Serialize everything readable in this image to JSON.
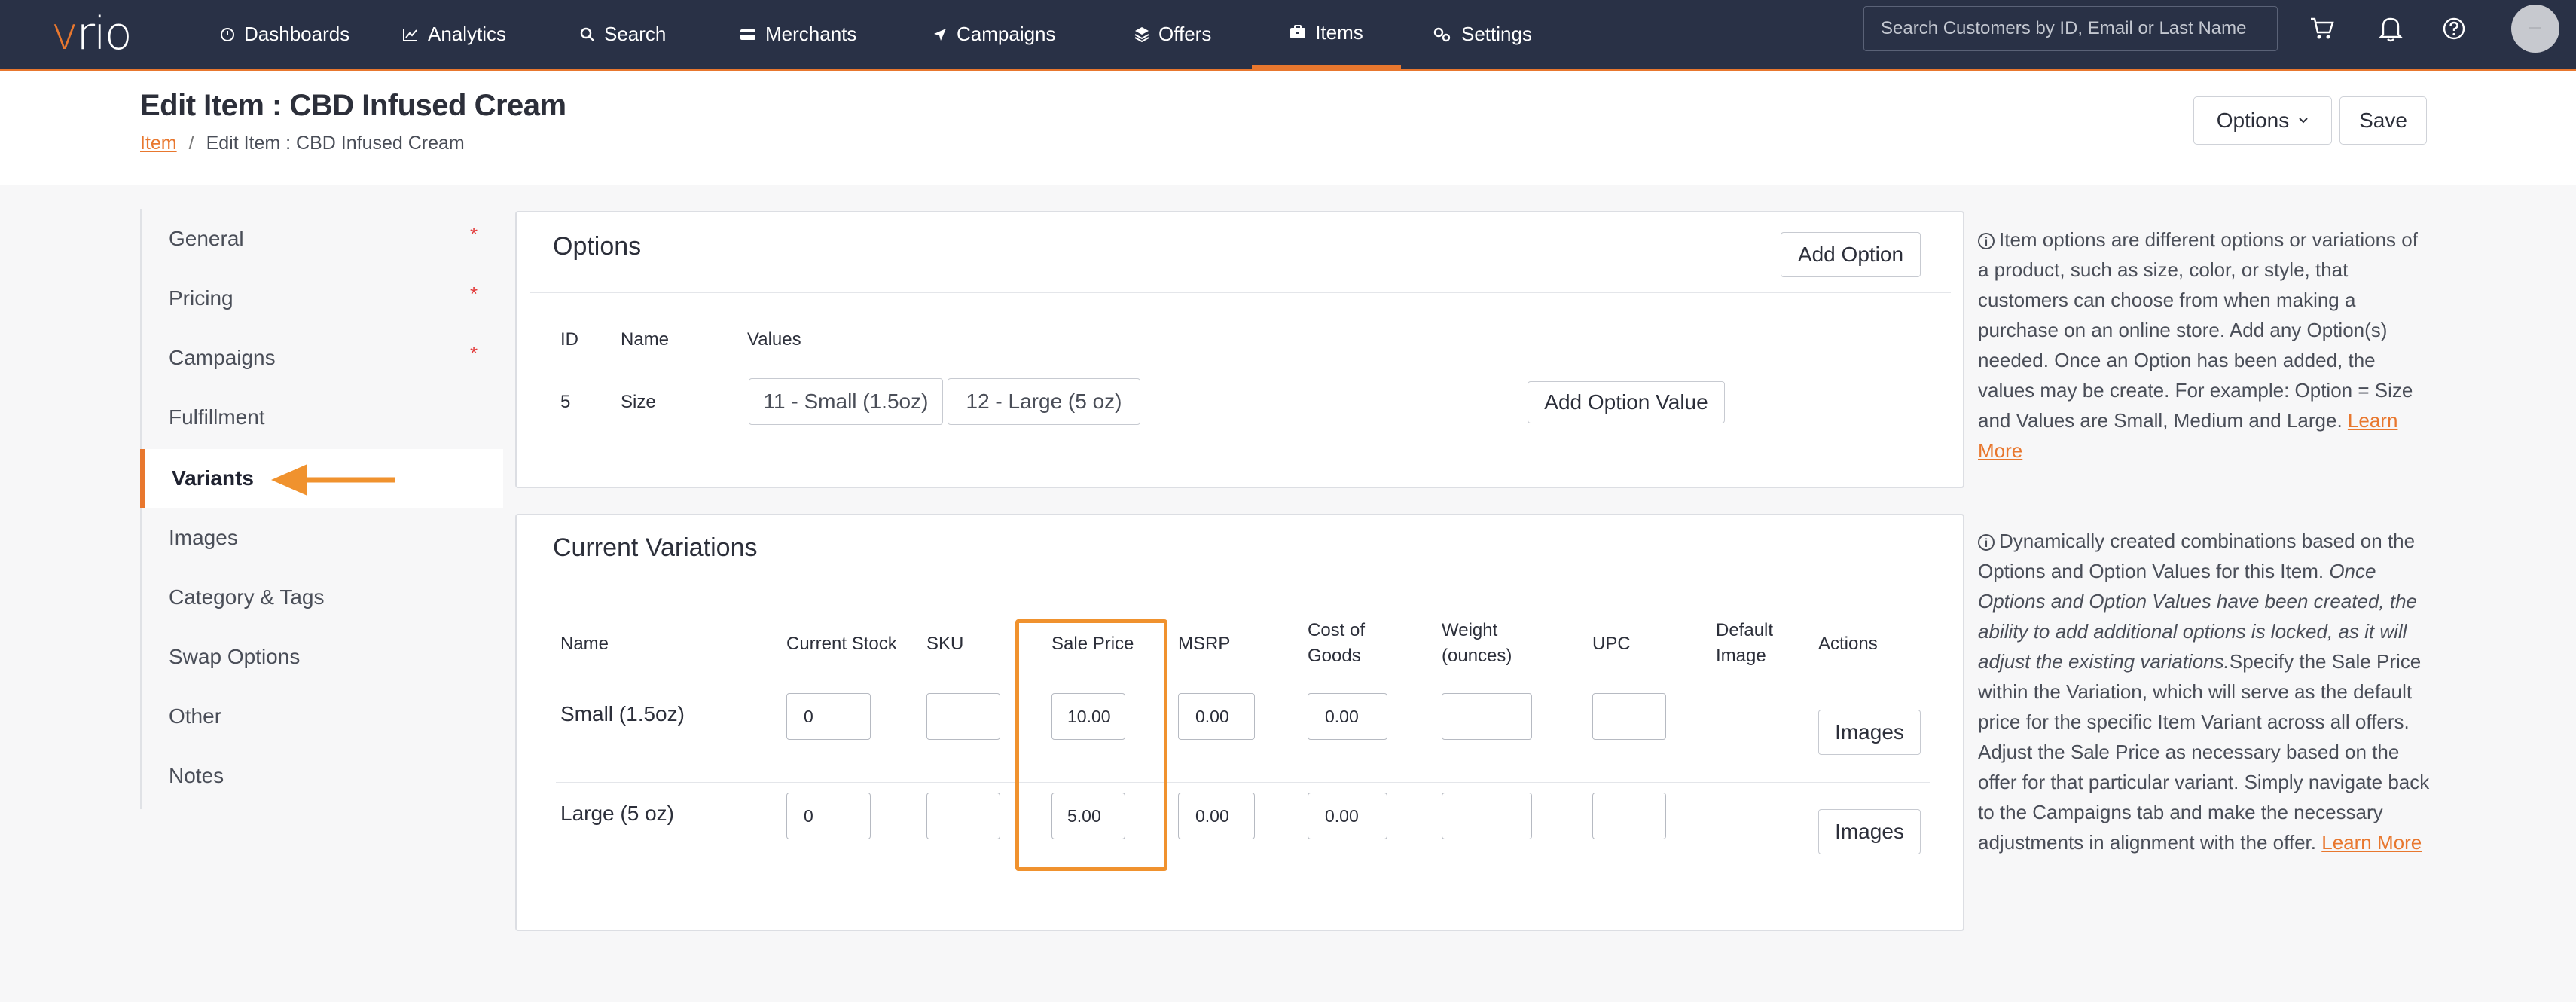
{
  "nav": {
    "logo": "vrio",
    "items": [
      {
        "label": "Dashboards",
        "icon": "dashboard-icon"
      },
      {
        "label": "Analytics",
        "icon": "analytics-icon"
      },
      {
        "label": "Search",
        "icon": "search-icon"
      },
      {
        "label": "Merchants",
        "icon": "merchants-icon"
      },
      {
        "label": "Campaigns",
        "icon": "campaigns-icon"
      },
      {
        "label": "Offers",
        "icon": "offers-icon"
      },
      {
        "label": "Items",
        "icon": "items-icon",
        "active": true
      },
      {
        "label": "Settings",
        "icon": "settings-icon"
      }
    ],
    "search_placeholder": "Search Customers by ID, Email or Last Name",
    "accent": "#e8772e",
    "background": "#293146"
  },
  "header": {
    "title": "Edit Item : CBD Infused Cream",
    "breadcrumb": {
      "link": "Item",
      "sep": "/",
      "current": "Edit Item : CBD Infused Cream"
    },
    "options_label": "Options",
    "save_label": "Save"
  },
  "sidebar": {
    "items": [
      {
        "label": "General",
        "required": "*"
      },
      {
        "label": "Pricing",
        "required": "*"
      },
      {
        "label": "Campaigns",
        "required": "*"
      },
      {
        "label": "Fulfillment"
      },
      {
        "label": "Variants",
        "active": true
      },
      {
        "label": "Images"
      },
      {
        "label": "Category & Tags"
      },
      {
        "label": "Swap Options"
      },
      {
        "label": "Other"
      },
      {
        "label": "Notes"
      }
    ]
  },
  "options_panel": {
    "title": "Options",
    "add_option": "Add Option",
    "columns": [
      "ID",
      "Name",
      "Values"
    ],
    "rows": [
      {
        "id": "5",
        "name": "Size",
        "values": [
          "11 - Small (1.5oz)",
          "12 - Large (5 oz)"
        ],
        "add_value": "Add Option Value"
      }
    ]
  },
  "variations_panel": {
    "title": "Current Variations",
    "columns": [
      "Name",
      "Current Stock",
      "SKU",
      "Sale Price",
      "MSRP",
      "Cost of Goods",
      "Weight (ounces)",
      "UPC",
      "Default Image",
      "Actions"
    ],
    "rows": [
      {
        "name": "Small (1.5oz)",
        "stock": "0",
        "sku": "",
        "sale_price": "10.00",
        "msrp": "0.00",
        "cost": "0.00",
        "weight": "",
        "upc": "",
        "action": "Images"
      },
      {
        "name": "Large (5 oz)",
        "stock": "0",
        "sku": "",
        "sale_price": "5.00",
        "msrp": "0.00",
        "cost": "0.00",
        "weight": "",
        "upc": "",
        "action": "Images"
      }
    ]
  },
  "help": {
    "options_text": "Item options are different options or variations of a product, such as size, color, or style, that customers can choose from when making a purchase on an online store. Add any Option(s) needed. Once an Option has been added, the values may be create. For example: Option = Size and Values are Small, Medium and Large.",
    "options_link": "Learn More",
    "variations_text_1": "Dynamically created combinations based on the Options and Option Values for this Item.",
    "variations_text_italic": "Once Options and Option Values have been created, the ability to add additional options is locked, as it will adjust the existing variations.",
    "variations_text_2": "Specify the Sale Price within the Variation, which will serve as the default price for the specific Item Variant across all offers. Adjust the Sale Price as necessary based on the offer for that particular variant. Simply navigate back to the Campaigns tab and make the necessary adjustments in alignment with the offer.",
    "variations_link": "Learn More",
    "icon": "info-icon"
  }
}
